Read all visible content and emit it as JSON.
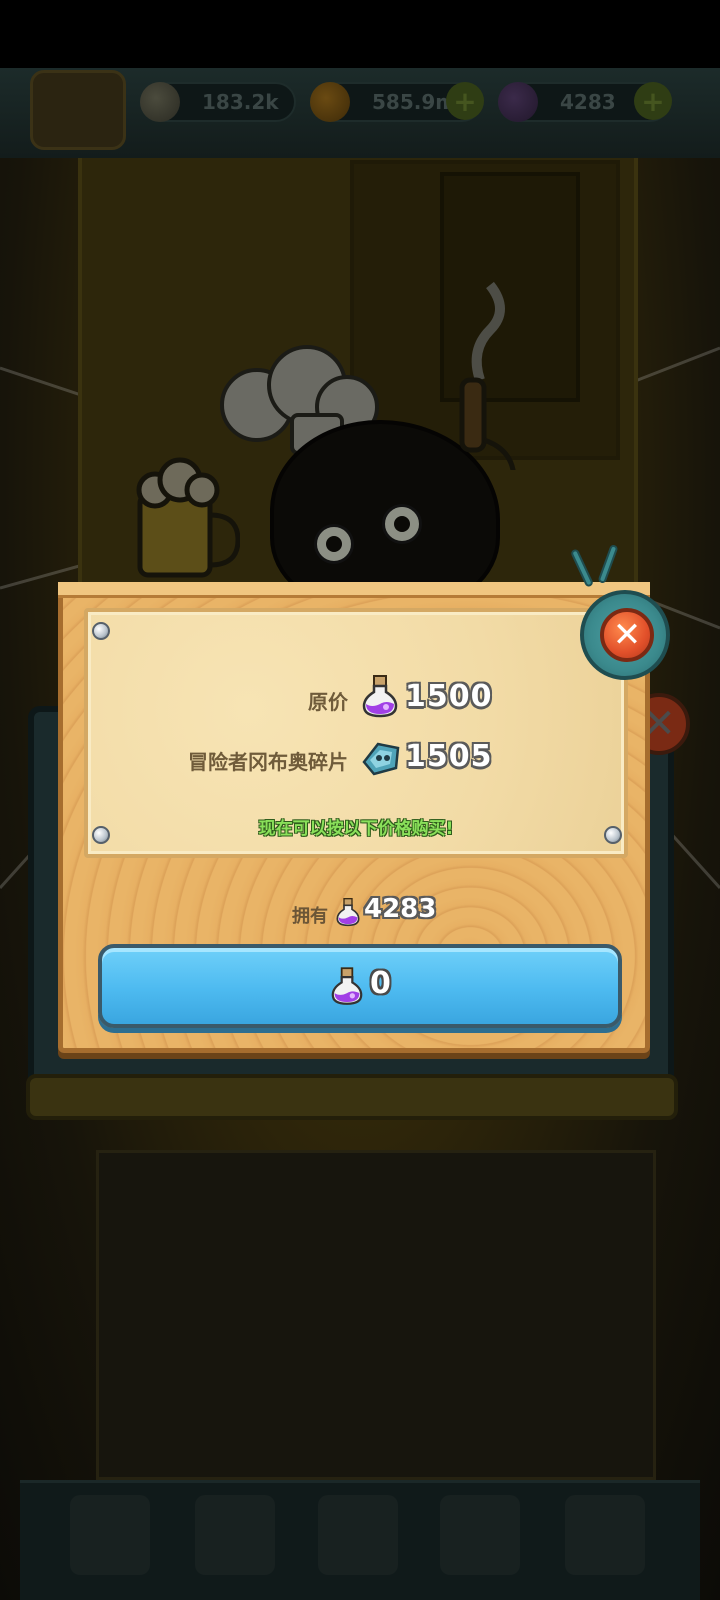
{
  "hud": {
    "eyes_value": "183.2k",
    "coins_value": "585.9m",
    "potions_value": "4283"
  },
  "dialog": {
    "original_price_label": "原价",
    "original_price_value": "1500",
    "fragment_label": "冒险者冈布奥碎片",
    "fragment_value": "1505",
    "notice": "现在可以按以下价格购买!",
    "owned_label": "拥有",
    "owned_value": "4283",
    "buy_value": "0",
    "close_symbol": "✕"
  },
  "background_close_symbol": "✕",
  "icons": {
    "currency": "purple-potion-icon",
    "fragment": "gumball-fragment-icon",
    "eyes": "eyeball-icon",
    "coins": "coin-icon",
    "close": "close-icon"
  },
  "colors": {
    "buy_button": "#4dbaf0",
    "close_button": "#e2502a",
    "notice_text": "#8ae05a",
    "board_wood": "#e9b467",
    "parchment": "#f2dba6"
  }
}
